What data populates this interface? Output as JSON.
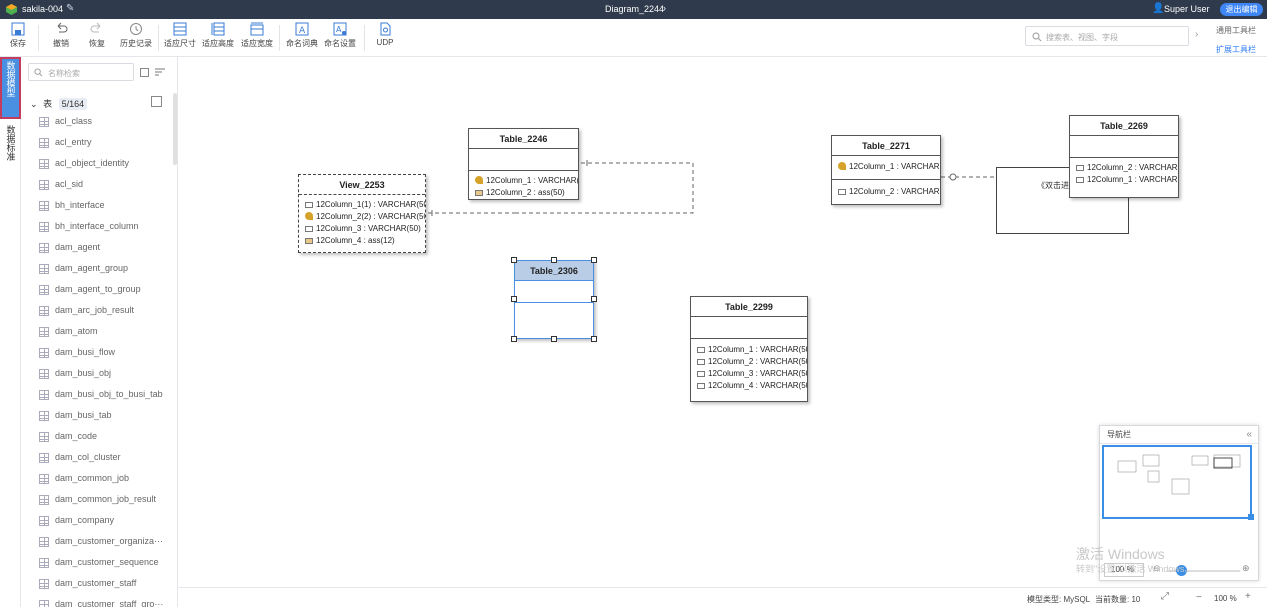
{
  "title_bar": {
    "project_name": "sakila-004",
    "diagram_name": "Diagram_2244",
    "user_name": "Super User",
    "exit_edit_label": "退出编辑"
  },
  "toolbar": {
    "save": "保存",
    "undo": "撤销",
    "redo": "恢复",
    "history": "历史记录",
    "fit_size": "适应尺寸",
    "fit_height": "适应高度",
    "fit_width": "适应宽度",
    "naming_dict": "命名词典",
    "naming_settings": "命名设置",
    "udp": "UDP",
    "search_placeholder": "搜索表、视图、字段",
    "general_toolbar": "通用工具栏",
    "extended_toolbar": "扩展工具栏"
  },
  "left_tabs": {
    "data_model": "数据模型",
    "data_standard": "数据标准"
  },
  "sidebar": {
    "search_placeholder": "名称检索",
    "tree_root_label": "表",
    "tree_root_count": "5/164",
    "tables": [
      "acl_class",
      "acl_entry",
      "acl_object_identity",
      "acl_sid",
      "bh_interface",
      "bh_interface_column",
      "dam_agent",
      "dam_agent_group",
      "dam_agent_to_group",
      "dam_arc_job_result",
      "dam_atom",
      "dam_busi_flow",
      "dam_busi_obj",
      "dam_busi_obj_to_busi_tab",
      "dam_busi_tab",
      "dam_code",
      "dam_col_cluster",
      "dam_common_job",
      "dam_common_job_result",
      "dam_company",
      "dam_customer_organiza···",
      "dam_customer_sequence",
      "dam_customer_staff",
      "dam_customer_staff_gro···"
    ]
  },
  "entities": {
    "table_2246": {
      "title": "Table_2246",
      "col1": "12Column_1 : VARCHAR(5···",
      "col2": "12Column_2 : ass(50)"
    },
    "view_2253": {
      "title": "View_2253",
      "col1": "12Column_1(1) : VARCHAR(50)",
      "col2": "12Column_2(2) : VARCHAR(50)",
      "col3": "12Column_3 : VARCHAR(50)",
      "col4": "12Column_4 : ass(12)"
    },
    "table_2306": {
      "title": "Table_2306"
    },
    "table_2299": {
      "title": "Table_2299",
      "col1": "12Column_1 : VARCHAR(50)",
      "col2": "12Column_2 : VARCHAR(50)",
      "col3": "12Column_3 : VARCHAR(50)",
      "col4": "12Column_4 : VARCHAR(50)"
    },
    "table_2271": {
      "title": "Table_2271",
      "col1": "12Column_1 : VARCHAR(…",
      "col2": "12Column_2 : VARCHAR(…"
    },
    "table_2269": {
      "title": "Table_2269",
      "col1": "12Column_2 : VARCHAR(…",
      "col2": "12Column_1 : VARCHAR(…"
    },
    "note_text": "《双击进…"
  },
  "status_bar": {
    "model_type": "模型类型: MySQL",
    "current_count": "当前数量: 10",
    "zoom": "100 %"
  },
  "navigator": {
    "title": "导航栏",
    "zoom": "100 %"
  },
  "watermark": {
    "line1": "激活 Windows",
    "line2": "转到\"设置\"以激活 Windows。"
  }
}
